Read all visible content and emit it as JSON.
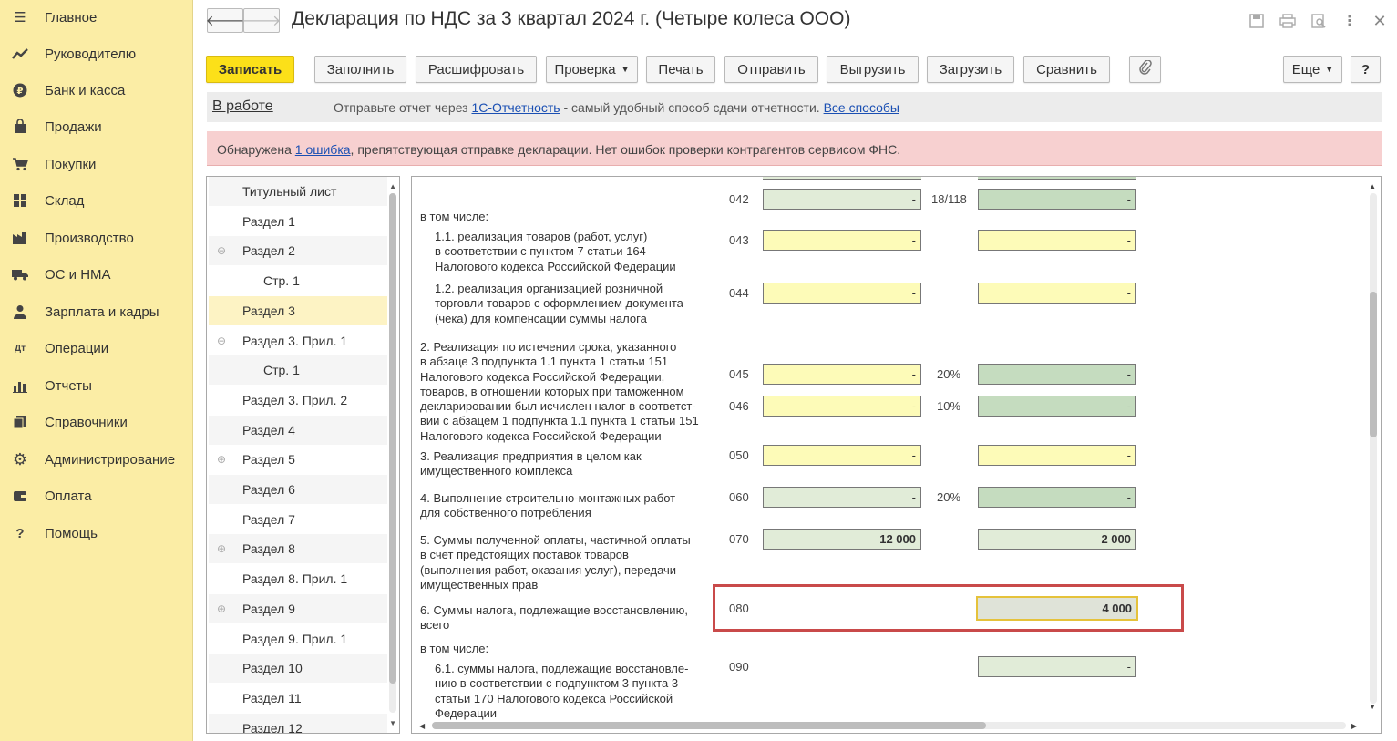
{
  "sidebar": {
    "items": [
      {
        "label": "Главное",
        "icon": "menu-icon"
      },
      {
        "label": "Руководителю",
        "icon": "trend-icon"
      },
      {
        "label": "Банк и касса",
        "icon": "ruble-icon"
      },
      {
        "label": "Продажи",
        "icon": "bag-icon"
      },
      {
        "label": "Покупки",
        "icon": "cart-icon"
      },
      {
        "label": "Склад",
        "icon": "warehouse-icon"
      },
      {
        "label": "Производство",
        "icon": "factory-icon"
      },
      {
        "label": "ОС и НМА",
        "icon": "truck-icon"
      },
      {
        "label": "Зарплата и кадры",
        "icon": "person-icon"
      },
      {
        "label": "Операции",
        "icon": "operations-icon"
      },
      {
        "label": "Отчеты",
        "icon": "bar-chart-icon"
      },
      {
        "label": "Справочники",
        "icon": "books-icon"
      },
      {
        "label": "Администрирование",
        "icon": "gear-icon"
      },
      {
        "label": "Оплата",
        "icon": "wallet-icon"
      },
      {
        "label": "Помощь",
        "icon": "help-icon"
      }
    ]
  },
  "window": {
    "title": "Декларация по НДС за 3 квартал 2024 г. (Четыре колеса ООО)"
  },
  "toolbar": {
    "save": "Записать",
    "fill": "Заполнить",
    "decode": "Расшифровать",
    "check": "Проверка",
    "print": "Печать",
    "send": "Отправить",
    "export": "Выгрузить",
    "import": "Загрузить",
    "compare": "Сравнить",
    "more": "Еще",
    "help": "?"
  },
  "status": {
    "state": "В работе",
    "msg_before": "Отправьте отчет через ",
    "link1": "1С-Отчетность",
    "msg_middle": " - самый удобный способ сдачи отчетности. ",
    "link2": "Все способы"
  },
  "error": {
    "before": "Обнаружена ",
    "link": "1 ошибка",
    "after": ", препятствующая отправке декларации. Нет ошибок проверки контрагентов сервисом ФНС."
  },
  "tree": {
    "items": [
      {
        "label": "Титульный лист",
        "indent": 0,
        "toggle": ""
      },
      {
        "label": "Раздел 1",
        "indent": 0,
        "toggle": ""
      },
      {
        "label": "Раздел 2",
        "indent": 0,
        "toggle": "⊖"
      },
      {
        "label": "Стр. 1",
        "indent": 1,
        "toggle": ""
      },
      {
        "label": "Раздел 3",
        "indent": 0,
        "toggle": "",
        "selected": true
      },
      {
        "label": "Раздел 3. Прил. 1",
        "indent": 0,
        "toggle": "⊖"
      },
      {
        "label": "Стр. 1",
        "indent": 1,
        "toggle": ""
      },
      {
        "label": "Раздел 3. Прил. 2",
        "indent": 0,
        "toggle": ""
      },
      {
        "label": "Раздел 4",
        "indent": 0,
        "toggle": ""
      },
      {
        "label": "Раздел 5",
        "indent": 0,
        "toggle": "⊕"
      },
      {
        "label": "Раздел 6",
        "indent": 0,
        "toggle": ""
      },
      {
        "label": "Раздел 7",
        "indent": 0,
        "toggle": ""
      },
      {
        "label": "Раздел 8",
        "indent": 0,
        "toggle": "⊕"
      },
      {
        "label": "Раздел 8. Прил. 1",
        "indent": 0,
        "toggle": ""
      },
      {
        "label": "Раздел 9",
        "indent": 0,
        "toggle": "⊕"
      },
      {
        "label": "Раздел 9. Прил. 1",
        "indent": 0,
        "toggle": ""
      },
      {
        "label": "Раздел 10",
        "indent": 0,
        "toggle": ""
      },
      {
        "label": "Раздел 11",
        "indent": 0,
        "toggle": ""
      },
      {
        "label": "Раздел 12",
        "indent": 0,
        "toggle": ""
      }
    ]
  },
  "form": {
    "texts": {
      "t_incl1": "в том числе:",
      "t_11": "1.1. реализация товаров (работ, услуг)\nв соответствии с пунктом 7 статьи 164\nНалогового кодекса Российской Федерации",
      "t_12": "1.2. реализация организацией розничной\nторговли товаров с оформлением документа\n(чека) для компенсации суммы налога",
      "t_2": "2. Реализация по истечении срока, указанного\nв абзаце 3 подпункта 1.1 пункта 1 статьи 151\nНалогового кодекса Российской Федерации,\nтоваров, в отношении которых при таможенном\nдекларировании был исчислен налог в соответст-\nвии с абзацем 1 подпункта 1.1 пункта 1 статьи 151\nНалогового кодекса Российской Федерации",
      "t_3": "3. Реализация предприятия в целом как\nимущественного комплекса",
      "t_4": "4. Выполнение строительно-монтажных работ\nдля собственного потребления",
      "t_5": "5. Суммы полученной оплаты, частичной оплаты\nв счет предстоящих поставок товаров\n(выполнения работ, оказания услуг), передачи\nимущественных прав",
      "t_6": "6. Суммы налога, подлежащие восстановлению,\nвсего",
      "t_incl2": "в том числе:",
      "t_61": "6.1. суммы налога, подлежащие восстановле-\nнию в соответствии с подпунктом 3 пункта 3\nстатьи 170 Налогового кодекса Российской\nФедерации"
    },
    "codes": {
      "c042": "042",
      "c043": "043",
      "c044": "044",
      "c045": "045",
      "c046": "046",
      "c050": "050",
      "c060": "060",
      "c070": "070",
      "c080": "080",
      "c090": "090"
    },
    "rates": {
      "r042": "18/118",
      "r045": "20%",
      "r046": "10%",
      "r060": "20%"
    },
    "values": {
      "dash": "-",
      "v070_base": "12 000",
      "v070_tax": "2 000",
      "v080_tax": "4 000"
    }
  }
}
